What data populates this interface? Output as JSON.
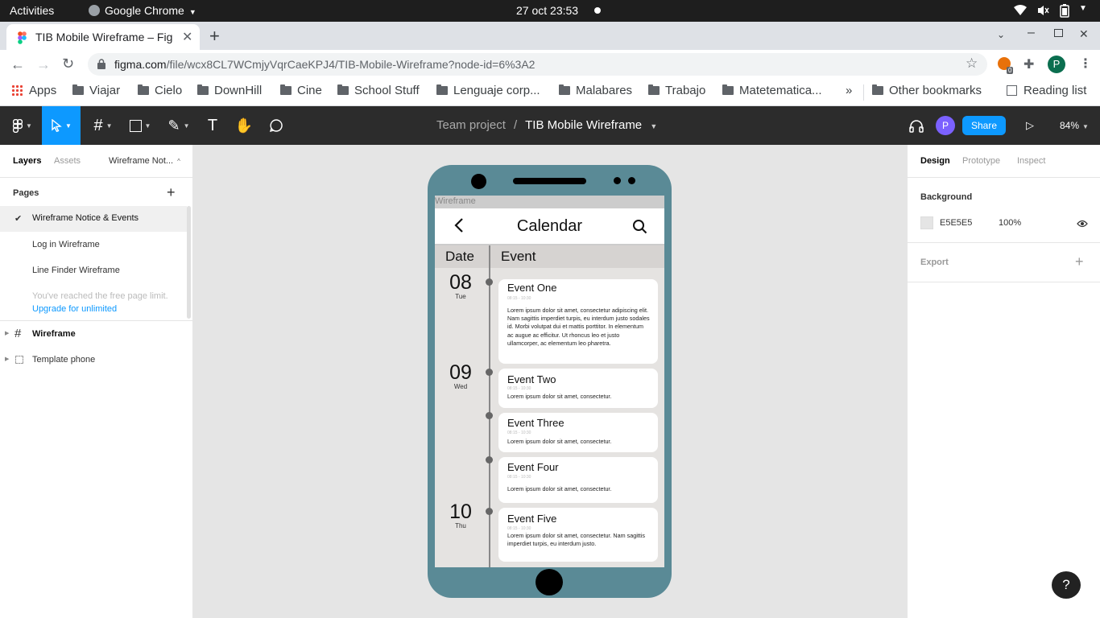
{
  "system": {
    "activities": "Activities",
    "app_name": "Google Chrome",
    "clock": "27 oct  23:53"
  },
  "browser": {
    "tab_title": "TIB Mobile Wireframe – Figma",
    "url_host": "figma.com",
    "url_path": "/file/wcx8CL7WCmjyVqrCaeKPJ4/TIB-Mobile-Wireframe?node-id=6%3A2",
    "profile_initial": "P",
    "extension_badge": "0",
    "bookmarks": [
      "Apps",
      "Viajar",
      "Cielo",
      "DownHill",
      "Cine",
      "School Stuff",
      "Lenguaje corp...",
      "Malabares",
      "Trabajo",
      "Matetematica..."
    ],
    "more_bookmarks": "»",
    "other_bookmarks": "Other bookmarks",
    "reading_list": "Reading list"
  },
  "figma": {
    "breadcrumb_team": "Team project",
    "breadcrumb_sep": "/",
    "file_name": "TIB Mobile Wireframe",
    "avatar_initial": "P",
    "share_label": "Share",
    "zoom": "84%",
    "left_tabs": {
      "layers": "Layers",
      "assets": "Assets",
      "page_dropdown": "Wireframe Not..."
    },
    "pages_heading": "Pages",
    "pages": [
      "Wireframe Notice & Events",
      "Log in Wireframe",
      "Line Finder Wireframe"
    ],
    "page_limit_note": "You've reached the free page limit.",
    "upgrade_link": "Upgrade for unlimited",
    "layers": [
      "Wireframe",
      "Template phone"
    ],
    "right_tabs": {
      "design": "Design",
      "prototype": "Prototype",
      "inspect": "Inspect"
    },
    "background_heading": "Background",
    "background_hex": "E5E5E5",
    "background_opacity": "100%",
    "background_color": "#E5E5E5",
    "export_heading": "Export",
    "help": "?"
  },
  "canvas": {
    "frame_label": "Wireframe",
    "phone_color": "#5A8A96",
    "app": {
      "title": "Calendar",
      "col_date": "Date",
      "col_event": "Event",
      "days": [
        {
          "num": "08",
          "name": "Tue"
        },
        {
          "num": "09",
          "name": "Wed"
        },
        {
          "num": "10",
          "name": "Thu"
        }
      ],
      "events": [
        {
          "title": "Event One",
          "time": "08:15 - 10:30",
          "text": "Lorem ipsum dolor sit amet, consectetur adipiscing elit. Nam sagittis imperdiet turpis, eu interdum justo sodales id. Morbi volutpat dui et mattis porttitor. In elementum ac augue ac efficitur. Ut rhoncus leo et justo ullamcorper, ac elementum leo pharetra."
        },
        {
          "title": "Event Two",
          "time": "08:15 - 10:30",
          "text": "Lorem ipsum dolor sit amet, consectetur."
        },
        {
          "title": "Event Three",
          "time": "08:15 - 10:30",
          "text": "Lorem ipsum dolor sit amet, consectetur."
        },
        {
          "title": "Event Four",
          "time": "08:15 - 10:30",
          "text": "Lorem ipsum dolor sit amet, consectetur."
        },
        {
          "title": "Event Five",
          "time": "08:15 - 10:30",
          "text": "Lorem ipsum dolor sit amet, consectetur.  Nam sagittis imperdiet turpis, eu interdum justo."
        }
      ]
    }
  }
}
